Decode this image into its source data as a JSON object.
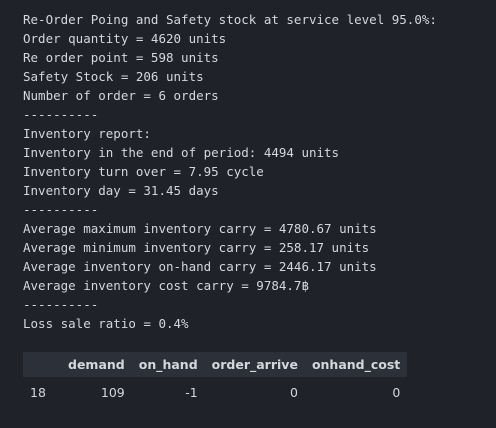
{
  "output": {
    "lines": [
      "Re-Order Poing and Safety stock at service level 95.0%:",
      "Order quantity = 4620 units",
      "Re order point = 598 units",
      "Safety Stock = 206 units",
      "Number of order = 6 orders",
      "----------",
      "Inventory report:",
      "Inventory in the end of period: 4494 units",
      "Inventory turn over = 7.95 cycle",
      "Inventory day = 31.45 days",
      "----------",
      "Average maximum inventory carry = 4780.67 units",
      "Average minimum inventory carry = 258.17 units",
      "Average inventory on-hand carry = 2446.17 units",
      "Average inventory cost carry = 9784.7฿",
      "----------",
      "Loss sale ratio = 0.4%"
    ]
  },
  "table": {
    "columns": [
      "",
      "demand",
      "on_hand",
      "order_arrive",
      "onhand_cost"
    ],
    "rows": [
      [
        "18",
        "109",
        "-1",
        "0",
        "0"
      ]
    ]
  }
}
